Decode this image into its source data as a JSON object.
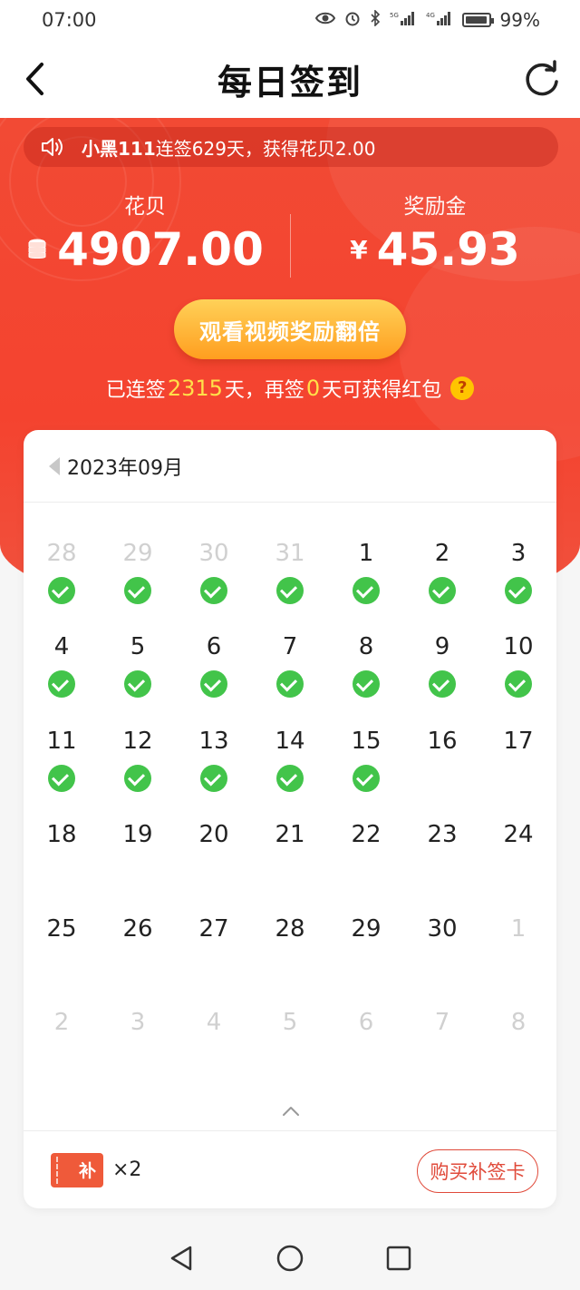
{
  "status_bar": {
    "time": "07:00",
    "network_1": "5G",
    "network_2": "4G",
    "battery": "99%"
  },
  "header": {
    "title": "每日签到"
  },
  "notice": {
    "user": "小黑111",
    "text": "连签629天，获得花贝2.00"
  },
  "balances": {
    "points_label": "花贝",
    "points_value": "4907.00",
    "reward_label": "奖励金",
    "reward_currency": "¥",
    "reward_value": "45.93"
  },
  "double_button": {
    "label": "观看视频奖励翻倍"
  },
  "streak": {
    "prefix": "已连签",
    "days": "2315",
    "middle": "天，再签",
    "remaining": "0",
    "suffix": "天可获得红包",
    "help": "?"
  },
  "calendar": {
    "month": "2023年09月",
    "days": [
      {
        "d": "28",
        "dim": true,
        "checked": true
      },
      {
        "d": "29",
        "dim": true,
        "checked": true
      },
      {
        "d": "30",
        "dim": true,
        "checked": true
      },
      {
        "d": "31",
        "dim": true,
        "checked": true
      },
      {
        "d": "1",
        "dim": false,
        "checked": true
      },
      {
        "d": "2",
        "dim": false,
        "checked": true
      },
      {
        "d": "3",
        "dim": false,
        "checked": true
      },
      {
        "d": "4",
        "dim": false,
        "checked": true
      },
      {
        "d": "5",
        "dim": false,
        "checked": true
      },
      {
        "d": "6",
        "dim": false,
        "checked": true
      },
      {
        "d": "7",
        "dim": false,
        "checked": true
      },
      {
        "d": "8",
        "dim": false,
        "checked": true
      },
      {
        "d": "9",
        "dim": false,
        "checked": true
      },
      {
        "d": "10",
        "dim": false,
        "checked": true
      },
      {
        "d": "11",
        "dim": false,
        "checked": true
      },
      {
        "d": "12",
        "dim": false,
        "checked": true
      },
      {
        "d": "13",
        "dim": false,
        "checked": true
      },
      {
        "d": "14",
        "dim": false,
        "checked": true
      },
      {
        "d": "15",
        "dim": false,
        "checked": true
      },
      {
        "d": "16",
        "dim": false,
        "checked": false
      },
      {
        "d": "17",
        "dim": false,
        "checked": false
      },
      {
        "d": "18",
        "dim": false,
        "checked": false
      },
      {
        "d": "19",
        "dim": false,
        "checked": false
      },
      {
        "d": "20",
        "dim": false,
        "checked": false
      },
      {
        "d": "21",
        "dim": false,
        "checked": false
      },
      {
        "d": "22",
        "dim": false,
        "checked": false
      },
      {
        "d": "23",
        "dim": false,
        "checked": false
      },
      {
        "d": "24",
        "dim": false,
        "checked": false
      },
      {
        "d": "25",
        "dim": false,
        "checked": false
      },
      {
        "d": "26",
        "dim": false,
        "checked": false
      },
      {
        "d": "27",
        "dim": false,
        "checked": false
      },
      {
        "d": "28",
        "dim": false,
        "checked": false
      },
      {
        "d": "29",
        "dim": false,
        "checked": false
      },
      {
        "d": "30",
        "dim": false,
        "checked": false
      },
      {
        "d": "1",
        "dim": true,
        "checked": false
      },
      {
        "d": "2",
        "dim": true,
        "checked": false
      },
      {
        "d": "3",
        "dim": true,
        "checked": false
      },
      {
        "d": "4",
        "dim": true,
        "checked": false
      },
      {
        "d": "5",
        "dim": true,
        "checked": false
      },
      {
        "d": "6",
        "dim": true,
        "checked": false
      },
      {
        "d": "7",
        "dim": true,
        "checked": false
      },
      {
        "d": "8",
        "dim": true,
        "checked": false
      }
    ]
  },
  "footer": {
    "ticket_label": "补",
    "ticket_count": "×2",
    "buy_button": "购买补签卡"
  },
  "colors": {
    "brand_red": "#f24a34",
    "check_green": "#42c44a",
    "highlight_yellow": "#ffe04a"
  },
  "icons": {
    "back": "chevron-left-icon",
    "refresh": "refresh-icon",
    "notice": "speaker-icon",
    "coins": "coin-stack-icon",
    "help": "question-icon",
    "collapse": "chevron-up-icon"
  }
}
